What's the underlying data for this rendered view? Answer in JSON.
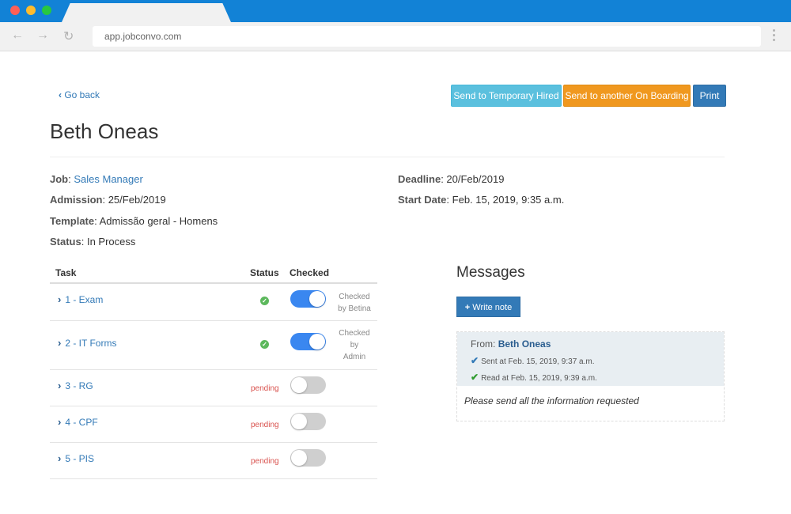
{
  "browser": {
    "url": "app.jobconvo.com"
  },
  "header": {
    "go_back": "Go back",
    "buttons": {
      "temporary_hired": "Send to Temporary Hired",
      "another_onboarding": "Send to another On Boarding",
      "print": "Print"
    },
    "candidate_name": "Beth Oneas"
  },
  "details": {
    "job_label": "Job",
    "job_value": "Sales Manager",
    "admission_label": "Admission",
    "admission_value": "25/Feb/2019",
    "template_label": "Template",
    "template_value": "Admissão geral - Homens",
    "status_label": "Status",
    "status_value": "In Process",
    "deadline_label": "Deadline",
    "deadline_value": "20/Feb/2019",
    "start_label": "Start Date",
    "start_value": "Feb. 15, 2019, 9:35 a.m."
  },
  "tasks": {
    "headers": {
      "task": "Task",
      "status": "Status",
      "checked": "Checked"
    },
    "rows": [
      {
        "label": "1 - Exam",
        "status": "done",
        "checked": true,
        "checked_by": [
          "Checked",
          "by Betina"
        ]
      },
      {
        "label": "2 - IT Forms",
        "status": "done",
        "checked": true,
        "checked_by": [
          "Checked",
          "by",
          "Admin"
        ]
      },
      {
        "label": "3 - RG",
        "status": "pending",
        "status_text": "pending",
        "checked": false
      },
      {
        "label": "4 - CPF",
        "status": "pending",
        "status_text": "pending",
        "checked": false
      },
      {
        "label": "5 - PIS",
        "status": "pending",
        "status_text": "pending",
        "checked": false
      }
    ]
  },
  "messages": {
    "title": "Messages",
    "write_note": "Write note",
    "items": [
      {
        "from_label": "From:",
        "from_name": "Beth Oneas",
        "sent": "Sent at Feb. 15, 2019, 9:37 a.m.",
        "read": "Read at Feb. 15, 2019, 9:39 a.m.",
        "body": "Please send all the information requested"
      }
    ]
  },
  "colors": {
    "primary": "#337ab7",
    "info": "#5bc0de",
    "warning": "#f0981f",
    "toggle_on": "#3a87f0",
    "pending": "#d9534f"
  }
}
